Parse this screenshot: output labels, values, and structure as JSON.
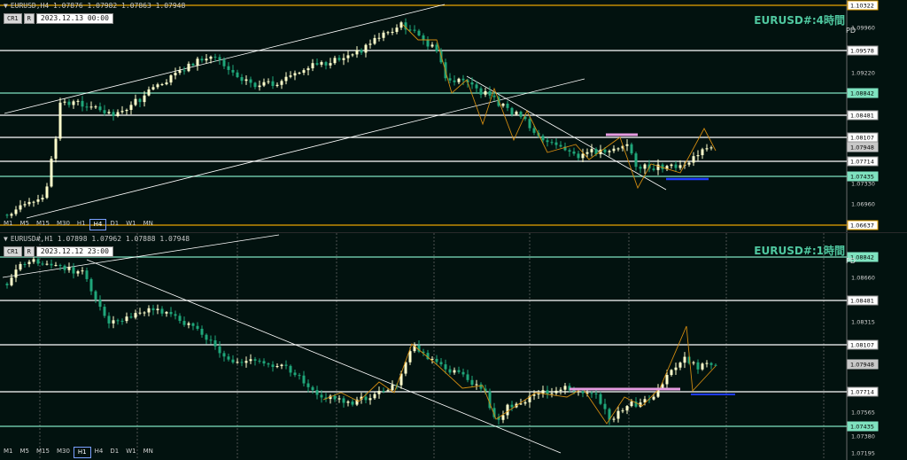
{
  "top": {
    "title": "EURUSD,H4  1.07876 1.07982 1.07863 1.07948",
    "badge_cr": "CR1",
    "badge_r": "R",
    "date_tag": "2023.12.13 00:00",
    "symbol_label": "EURUSD#:4時間",
    "pd": "PD",
    "timeframes": [
      "M1",
      "M5",
      "M15",
      "M30",
      "H1",
      "H4",
      "D1",
      "W1",
      "MN"
    ],
    "active_timeframe": "H4",
    "price_labels": [
      {
        "text": "1.10322",
        "style": "box-orange"
      },
      {
        "text": "1.09960",
        "style": "plain"
      },
      {
        "text": "1.09578",
        "style": "box-white"
      },
      {
        "text": "1.09220",
        "style": "plain"
      },
      {
        "text": "1.08842",
        "style": "box-teal"
      },
      {
        "text": "1.08481",
        "style": "box-white"
      },
      {
        "text": "1.08107",
        "style": "box-white"
      },
      {
        "text": "1.07948",
        "style": "box-gray"
      },
      {
        "text": "1.07714",
        "style": "box-white"
      },
      {
        "text": "1.07435",
        "style": "box-teal"
      },
      {
        "text": "1.07330",
        "style": "plain"
      },
      {
        "text": "1.06960",
        "style": "plain"
      },
      {
        "text": "1.06637",
        "style": "box-orange"
      }
    ]
  },
  "bottom": {
    "title": "EURUSD#,H1  1.07898 1.07962 1.07888 1.07948",
    "badge_cr": "CR1",
    "badge_r": "R",
    "date_tag": "2023.12.12 23:00",
    "symbol_label": "EURUSD#:1時間",
    "pd": "PD",
    "timeframes": [
      "M1",
      "M5",
      "M15",
      "M30",
      "H1",
      "H4",
      "D1",
      "W1",
      "MN"
    ],
    "active_timeframe": "H1",
    "price_labels": [
      {
        "text": "1.08842",
        "style": "box-teal"
      },
      {
        "text": "1.08660",
        "style": "plain"
      },
      {
        "text": "1.08481",
        "style": "box-white"
      },
      {
        "text": "1.08315",
        "style": "plain"
      },
      {
        "text": "1.08107",
        "style": "box-white"
      },
      {
        "text": "1.07948",
        "style": "box-gray"
      },
      {
        "text": "1.07714",
        "style": "box-white"
      },
      {
        "text": "1.07565",
        "style": "plain"
      },
      {
        "text": "1.07435",
        "style": "box-teal"
      },
      {
        "text": "1.07380",
        "style": "plain"
      },
      {
        "text": "1.07195",
        "style": "plain"
      }
    ]
  },
  "colors": {
    "bg": "#02120f",
    "bull": "#ffffcc",
    "bear": "#1fa67a",
    "white_line": "#ffffff",
    "teal_line": "#7fe3c0",
    "zigzag": "#d08a10",
    "pink": "#e59be0",
    "blue": "#1f3bff",
    "orange_box": "#e8a400"
  }
}
